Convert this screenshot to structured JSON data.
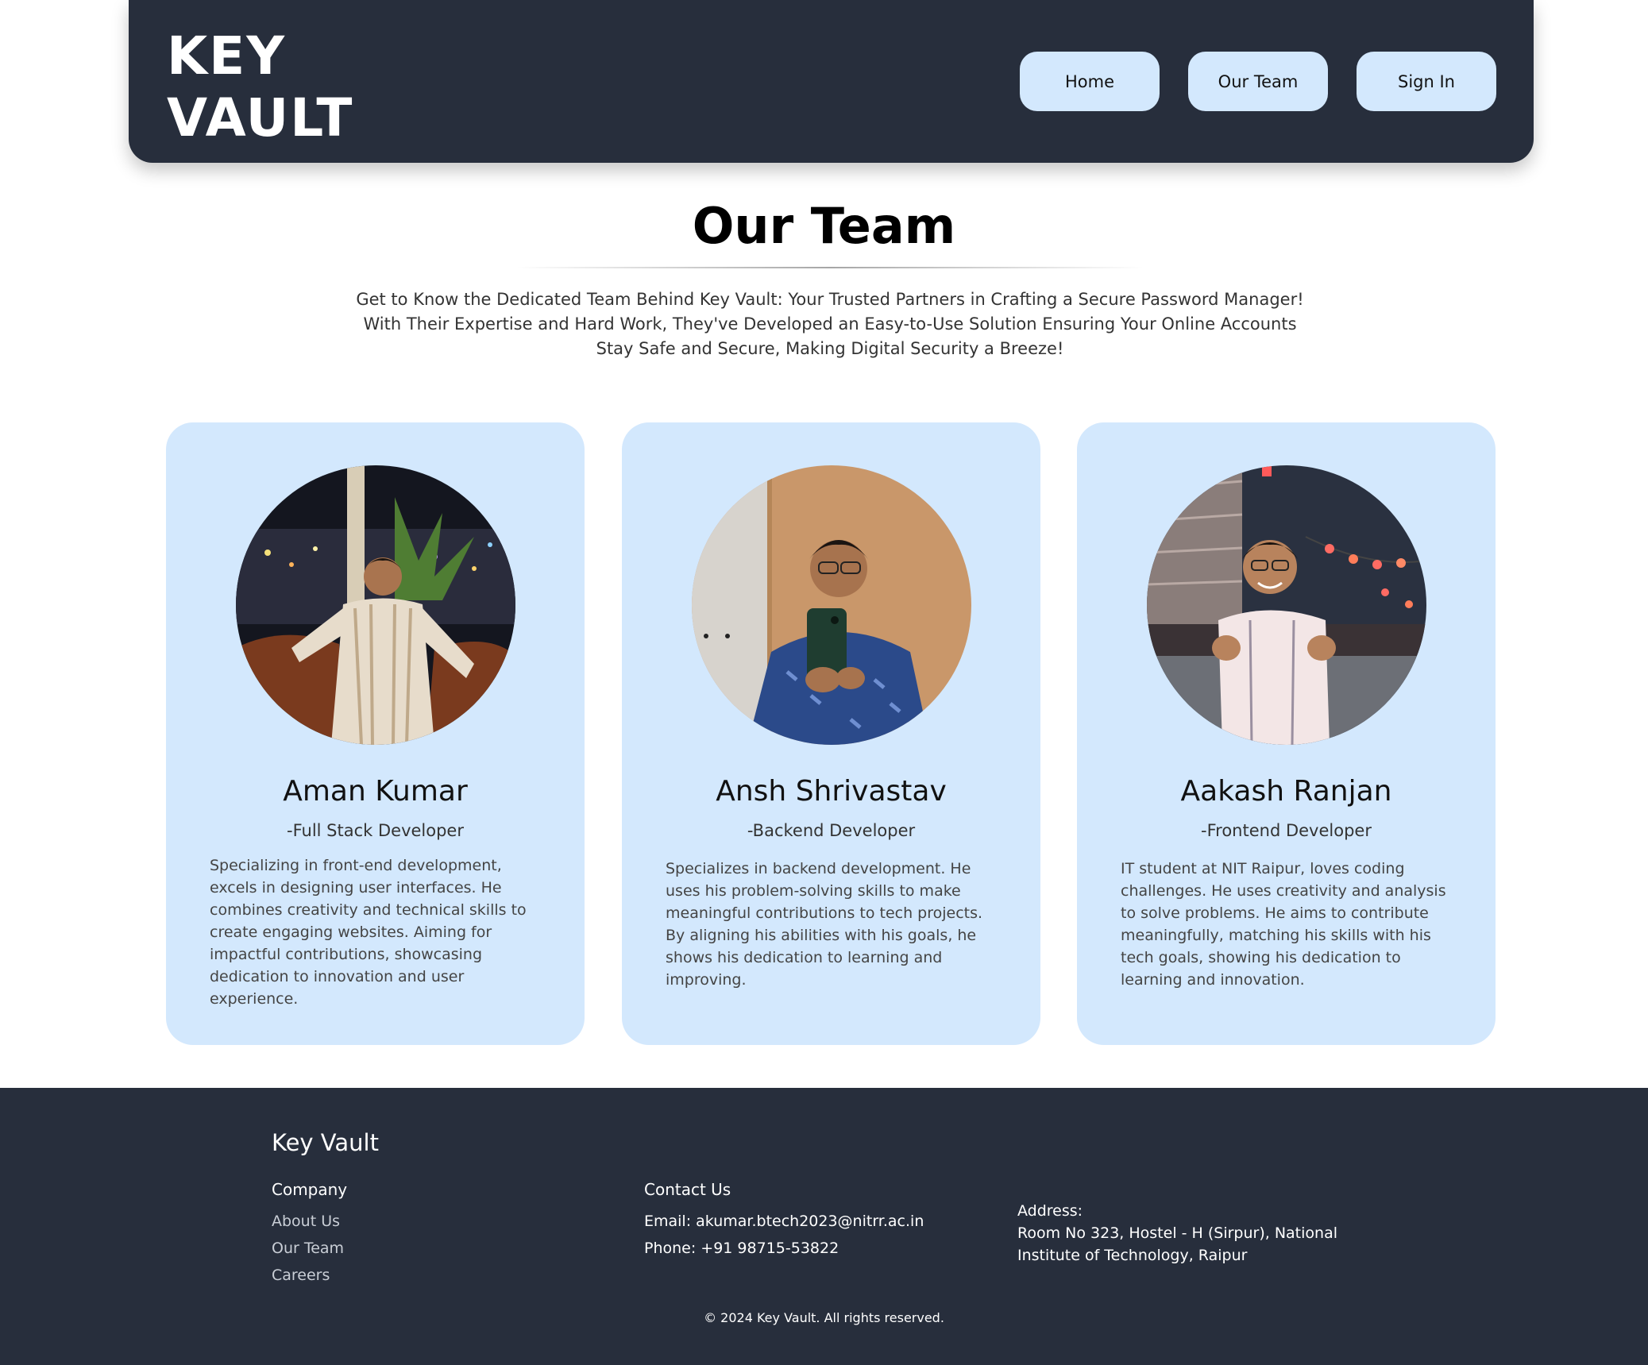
{
  "header": {
    "logo_line1": "KEY",
    "logo_line2": "VAULT",
    "nav": [
      {
        "label": "Home"
      },
      {
        "label": "Our Team"
      },
      {
        "label": "Sign In"
      }
    ]
  },
  "hero": {
    "title": "Our Team",
    "intro_lines": [
      "Get to Know the Dedicated Team Behind Key Vault: Your Trusted Partners in Crafting a Secure Password Manager!",
      "With Their Expertise and Hard Work, They've Developed an Easy-to-Use Solution Ensuring Your Online Accounts",
      "Stay Safe and Secure, Making Digital Security a Breeze!"
    ]
  },
  "team": [
    {
      "name": "Aman Kumar",
      "role": "-Full Stack Developer",
      "description": "Specializing in front-end development, excels in designing user interfaces. He combines creativity and technical skills to create engaging websites. Aiming for impactful contributions, showcasing dedication to innovation and user experience."
    },
    {
      "name": "Ansh Shrivastav",
      "role": "-Backend Developer",
      "description": "Specializes in backend development. He uses his problem-solving skills to make meaningful contributions to tech projects. By aligning his abilities with his goals, he shows his dedication to learning and improving."
    },
    {
      "name": "Aakash Ranjan",
      "role": "-Frontend Developer",
      "description": "IT student at NIT Raipur, loves coding challenges. He uses creativity and analysis to solve problems. He aims to contribute meaningfully, matching his skills with his tech goals, showing his dedication to learning and innovation."
    }
  ],
  "footer": {
    "brand": "Key Vault",
    "company_heading": "Company",
    "company_links": [
      "About Us",
      "Our Team",
      "Careers"
    ],
    "contact_heading": "Contact Us",
    "email": "Email: akumar.btech2023@nitrr.ac.in",
    "phone": "Phone: +91 98715-53822",
    "address_label": "Address:",
    "address_line1": "Room No 323, Hostel - H (Sirpur), National",
    "address_line2": "Institute of Technology, Raipur",
    "copyright": "© 2024 Key Vault. All rights reserved."
  }
}
